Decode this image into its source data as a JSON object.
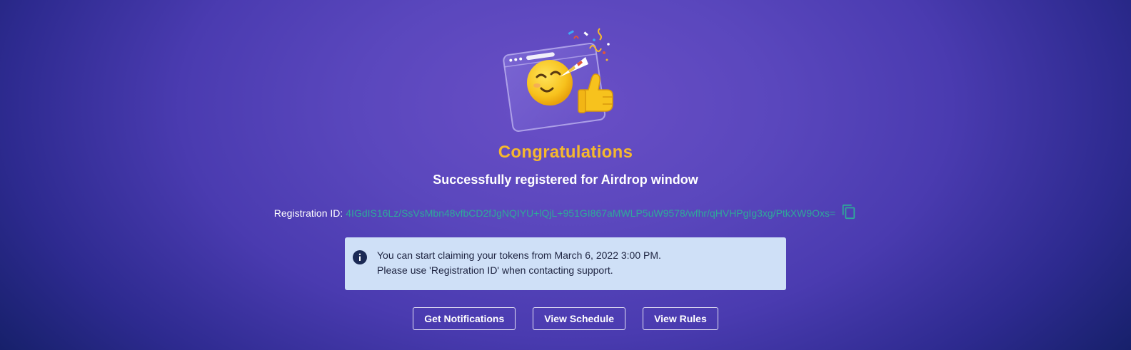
{
  "success": {
    "title": "Congratulations",
    "subtitle": "Successfully registered for Airdrop window"
  },
  "registration": {
    "label": "Registration ID:",
    "id": "4IGdIS16Lz/SsVsMbn48vfbCD2fJgNQIYU+lQjL+951GI867aMWLP5uW9578/wfhr/qHVHPgIg3xg/PtkXW9Oxs="
  },
  "notice": {
    "line1": "You can start claiming your tokens from March 6, 2022 3:00 PM.",
    "line2": "Please use 'Registration ID' when contacting support."
  },
  "actions": {
    "notifications_label": "Get Notifications",
    "schedule_label": "View Schedule",
    "rules_label": "View Rules"
  },
  "colors": {
    "title": "#f5b82e",
    "registration_id": "#2fa89a",
    "notice_background": "#cfe0f7",
    "info_icon": "#1b2a55"
  },
  "icons": {
    "illustration": "party-emoji-thumbs-up-illustration",
    "copy": "copy-icon",
    "info": "info-icon"
  }
}
